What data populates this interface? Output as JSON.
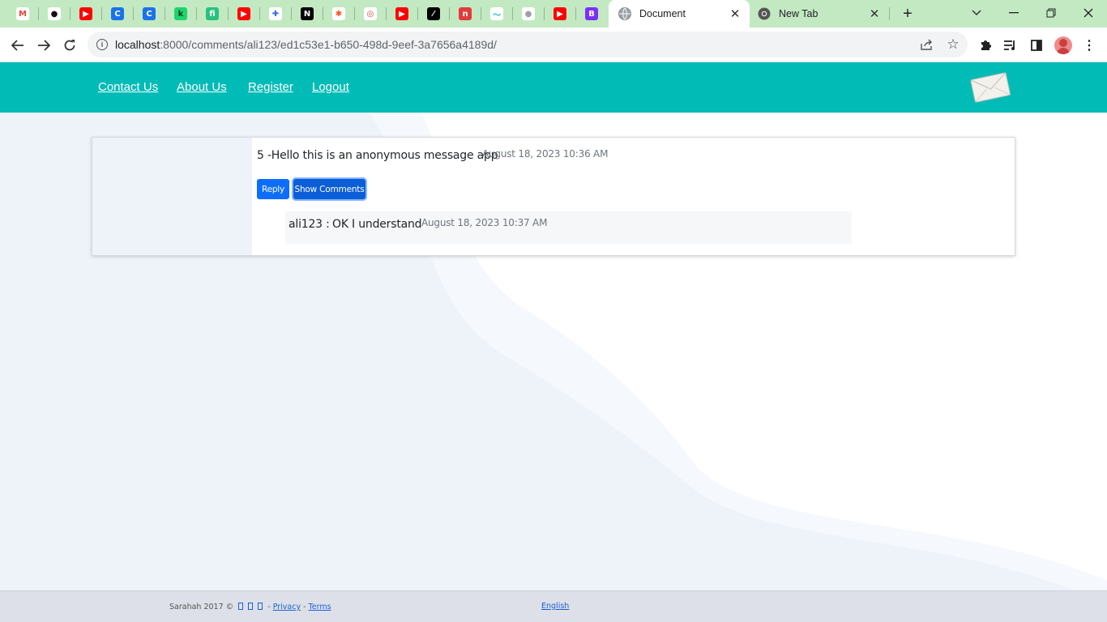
{
  "browser": {
    "pinned_tabs": [
      {
        "icon": "gmail-icon",
        "glyph": "M",
        "bg": "#ffffff",
        "fg": "#ea4335"
      },
      {
        "icon": "github-icon",
        "glyph": "●",
        "bg": "#ffffff",
        "fg": "#111111"
      },
      {
        "icon": "youtube-icon",
        "glyph": "▶",
        "bg": "#ff0000",
        "fg": "#ffffff"
      },
      {
        "icon": "c-app-icon",
        "glyph": "C",
        "bg": "#1a73e8",
        "fg": "#ffffff"
      },
      {
        "icon": "c-app-icon",
        "glyph": "C",
        "bg": "#1a73e8",
        "fg": "#ffffff"
      },
      {
        "icon": "ck-app-icon",
        "glyph": "k",
        "bg": "#1cd66c",
        "fg": "#0a3d1f"
      },
      {
        "icon": "fn-app-icon",
        "glyph": "fi",
        "bg": "#27c27d",
        "fg": "#ffffff"
      },
      {
        "icon": "youtube-icon",
        "glyph": "▶",
        "bg": "#ff0000",
        "fg": "#ffffff"
      },
      {
        "icon": "puzzle-app-icon",
        "glyph": "✚",
        "bg": "#ffffff",
        "fg": "#2b6de0"
      },
      {
        "icon": "next-app-icon",
        "glyph": "N",
        "bg": "#000000",
        "fg": "#ffffff"
      },
      {
        "icon": "asterisk-app-icon",
        "glyph": "✱",
        "bg": "#ffffff",
        "fg": "#ff4f1f"
      },
      {
        "icon": "spiral-app-icon",
        "glyph": "◎",
        "bg": "#ffffff",
        "fg": "#d0473a"
      },
      {
        "icon": "youtube-icon",
        "glyph": "▶",
        "bg": "#ff0000",
        "fg": "#ffffff"
      },
      {
        "icon": "slash-app-icon",
        "glyph": "⁄",
        "bg": "#000000",
        "fg": "#ffffff"
      },
      {
        "icon": "n-square-app-icon",
        "glyph": "n",
        "bg": "#e23b3b",
        "fg": "#ffffff"
      },
      {
        "icon": "tailwind-icon",
        "glyph": "〜",
        "bg": "#ffffff",
        "fg": "#22b8cf"
      },
      {
        "icon": "globe-icon",
        "glyph": "●",
        "bg": "#ffffff",
        "fg": "#9aa0a6"
      },
      {
        "icon": "youtube-icon",
        "glyph": "▶",
        "bg": "#ff0000",
        "fg": "#ffffff"
      },
      {
        "icon": "bootstrap-icon",
        "glyph": "B",
        "bg": "#7b2ff7",
        "fg": "#ffffff"
      }
    ],
    "tabs": [
      {
        "title": "Document",
        "active": true
      },
      {
        "title": "New Tab",
        "active": false
      }
    ],
    "url_host": "localhost",
    "url_rest": ":8000/comments/ali123/ed1c53e1-b650-498d-9eef-3a7656a4189d/"
  },
  "nav": {
    "links": [
      "Contact Us",
      "About Us",
      "Register",
      "Logout"
    ]
  },
  "message": {
    "text": "5 -Hello this is an anonymous message app",
    "timestamp": "August 18, 2023 10:36 AM",
    "reply_label": "Reply",
    "show_comments_label": "Show Comments"
  },
  "comment": {
    "user": "ali123 :",
    "text": "OK I understand",
    "timestamp": "August 18, 2023 10:37 AM"
  },
  "footer": {
    "copyright": "Sarahah 2017 ©",
    "dash1": "-",
    "privacy": "Privacy",
    "dash2": "-",
    "terms": "Terms",
    "language": "English"
  },
  "colors": {
    "header": "#00bbb6",
    "button": "#0d6efd",
    "tabstrip": "#c3e9c3"
  }
}
